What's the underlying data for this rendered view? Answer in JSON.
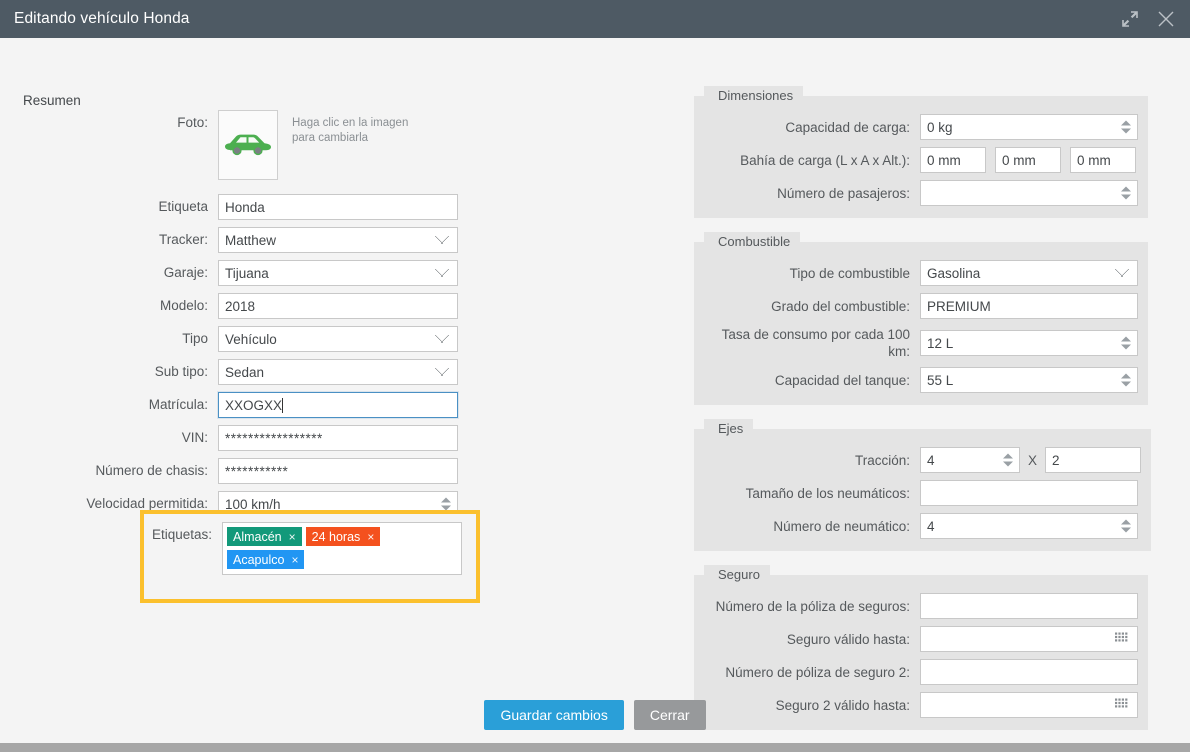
{
  "window": {
    "title": "Editando vehículo Honda",
    "restore_icon": "restore-window-icon",
    "close_icon": "close-icon",
    "titlebar_color": "#4e5a64"
  },
  "summary": {
    "section_label": "Resumen",
    "photo": {
      "label": "Foto:",
      "hint": "Haga clic en la imagen para cambiarla",
      "icon": "green-car-icon",
      "color": "#4caf50"
    },
    "fields": [
      {
        "label": "Etiqueta",
        "value": "Honda",
        "type": "text"
      },
      {
        "label": "Tracker:",
        "value": "Matthew",
        "type": "select"
      },
      {
        "label": "Garaje:",
        "value": "Tijuana",
        "type": "select"
      },
      {
        "label": "Modelo:",
        "value": "2018",
        "type": "text"
      },
      {
        "label": "Tipo",
        "value": "Vehículo",
        "type": "select"
      },
      {
        "label": "Sub tipo:",
        "value": "Sedan",
        "type": "select"
      },
      {
        "label": "Matrícula:",
        "value": "XXOGXX",
        "type": "text",
        "focused": true
      },
      {
        "label": "VIN:",
        "value": "*****************",
        "type": "text"
      },
      {
        "label": "Número de chasis:",
        "value": "***********",
        "type": "text"
      },
      {
        "label": "Velocidad permitida:",
        "value": "100  km/h",
        "type": "spinner"
      }
    ],
    "tags": {
      "label": "Etiquetas:",
      "highlight_color": "#fbc02d",
      "items": [
        {
          "text": "Almacén",
          "color": "#12997a",
          "remove": "×"
        },
        {
          "text": "24 horas",
          "color": "#f4511e",
          "remove": "×"
        },
        {
          "text": "Acapulco",
          "color": "#2196f3",
          "remove": "×"
        }
      ]
    }
  },
  "panels": {
    "dimensiones": {
      "legend": "Dimensiones",
      "capacidad_label": "Capacidad de carga:",
      "capacidad_value": "0  kg",
      "bahia_label": "Bahía de carga (L x A x Alt.):",
      "bahia_values": [
        "0  mm",
        "0  mm",
        "0  mm"
      ],
      "pasajeros_label": "Número de pasajeros:",
      "pasajeros_value": ""
    },
    "combustible": {
      "legend": "Combustible",
      "tipo_label": "Tipo de combustible",
      "tipo_value": "Gasolina",
      "grado_label": "Grado del combustible:",
      "grado_value": "PREMIUM",
      "tasa_label": "Tasa de consumo por cada 100 km:",
      "tasa_value": "12  L",
      "tanque_label": "Capacidad del tanque:",
      "tanque_value": "55  L"
    },
    "ejes": {
      "legend": "Ejes",
      "traccion_label": "Tracción:",
      "traccion_value": "4",
      "traccion_separator": "X",
      "traccion_value2": "2",
      "tamano_label": "Tamaño de los neumáticos:",
      "tamano_value": "",
      "numero_label": "Número de neumático:",
      "numero_value": "4"
    },
    "seguro": {
      "legend": "Seguro",
      "poliza_label": "Número de la póliza de seguros:",
      "poliza_value": "",
      "valido_label": "Seguro válido hasta:",
      "valido_value": "",
      "poliza2_label": "Número de póliza de seguro 2:",
      "poliza2_value": "",
      "valido2_label": "Seguro 2 válido hasta:",
      "valido2_value": "",
      "date_icon": "calendar-picker-icon"
    }
  },
  "footer": {
    "save_label": "Guardar cambios",
    "close_label": "Cerrar",
    "save_color": "#2a9fd8",
    "close_color": "#97999b"
  }
}
